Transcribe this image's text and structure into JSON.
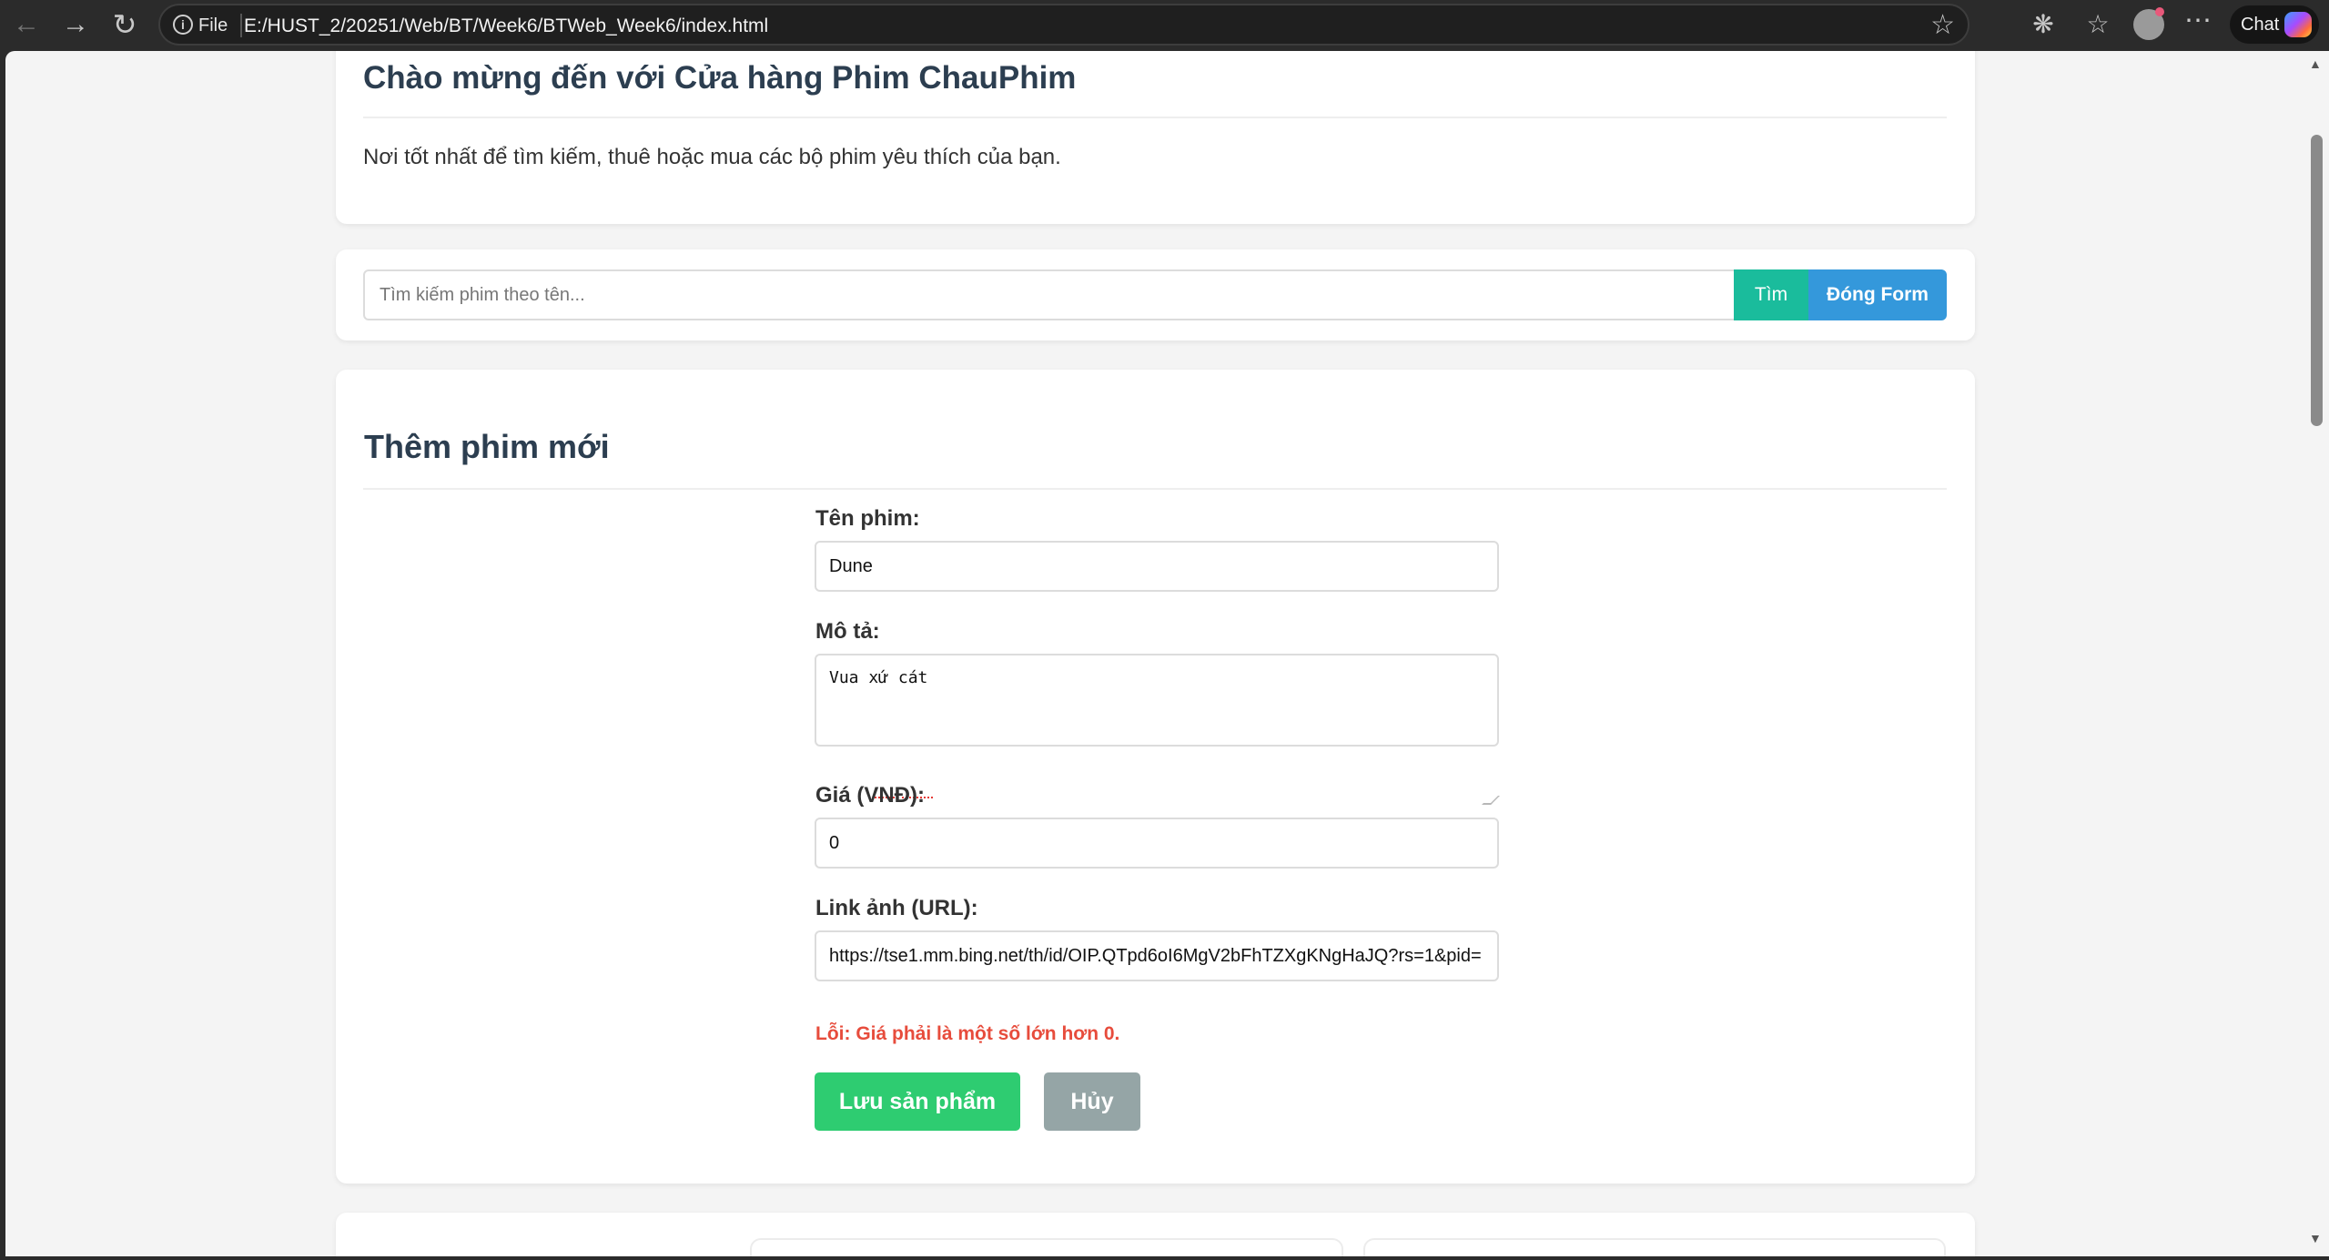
{
  "browser": {
    "file_label": "File",
    "url": "E:/HUST_2/20251/Web/BT/Week6/BTWeb_Week6/index.html",
    "chat_label": "Chat"
  },
  "hero": {
    "title": "Chào mừng đến với Cửa hàng Phim ChauPhim",
    "subtitle": "Nơi tốt nhất để tìm kiếm, thuê hoặc mua các bộ phim yêu thích của bạn."
  },
  "search": {
    "placeholder": "Tìm kiếm phim theo tên...",
    "search_label": "Tìm",
    "close_form_label": "Đóng Form"
  },
  "form": {
    "title": "Thêm phim mới",
    "name_label": "Tên phim:",
    "name_value": "Dune",
    "desc_label": "Mô tả:",
    "desc_value": "Vua xứ cát",
    "price_label": "Giá (VNĐ):",
    "price_value": "0",
    "image_label": "Link ảnh (URL):",
    "image_value": "https://tse1.mm.bing.net/th/id/OIP.QTpd6oI6MgV2bFhTZXgKNgHaJQ?rs=1&pid=",
    "error": "Lỗi: Giá phải là một số lớn hơn 0.",
    "save_label": "Lưu sản phẩm",
    "cancel_label": "Hủy"
  },
  "colors": {
    "accent_teal": "#1abc9c",
    "accent_blue": "#3498db",
    "save_green": "#2ecc71",
    "cancel_gray": "#95a5a6",
    "error_red": "#e74c3c",
    "heading": "#2c3e50"
  }
}
